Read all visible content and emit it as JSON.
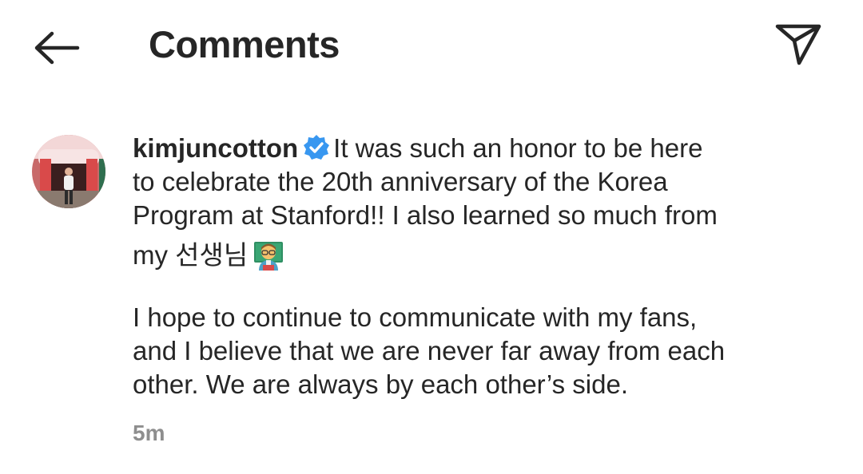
{
  "header": {
    "title": "Comments"
  },
  "comment": {
    "username": "kimjuncotton",
    "text_lines": [
      "It was such an honor to be here",
      "to celebrate the 20th anniversary of the Korea",
      "Program at Stanford!! I also learned so much from",
      "my 선생님"
    ],
    "paragraph2_lines": [
      "I hope to continue to communicate with my fans,",
      "and I believe that we are never far away from each",
      "other. We are always by each other’s side."
    ],
    "timestamp": "5m",
    "emoji": "teacher-emoji"
  },
  "colors": {
    "text": "#262626",
    "muted": "#8e8e8e",
    "verified": "#3897f0"
  }
}
